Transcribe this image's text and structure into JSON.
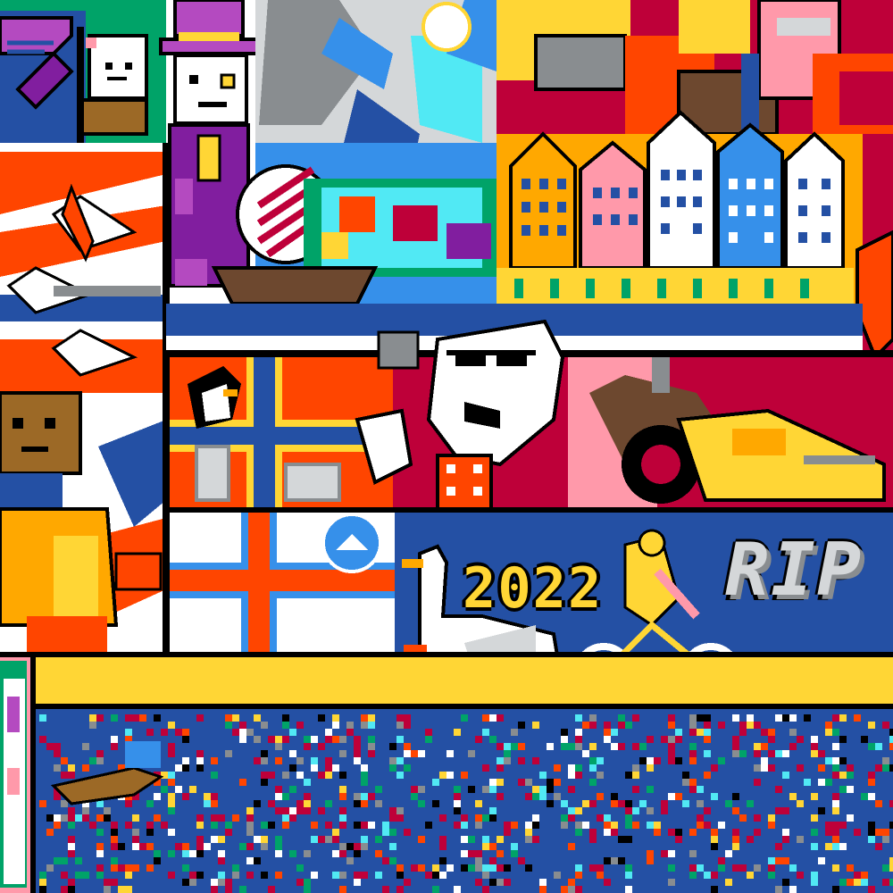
{
  "canvas": {
    "banner_year": "2022",
    "banner_partial_word": "RIP"
  },
  "palette": {
    "red": "#be0039",
    "orange": "#ff4500",
    "yellow": "#ffd635",
    "dark_blue": "#2450a4",
    "blue": "#3690ea",
    "light_blue": "#51e9f4",
    "white": "#ffffff",
    "light_gray": "#d4d7d9",
    "gray": "#898d90",
    "black": "#000000",
    "green": "#00a368",
    "purple": "#811e9f",
    "light_purple": "#b44ac0",
    "pink": "#ff99aa",
    "brown": "#9c6926",
    "dark_brown": "#6d482f"
  }
}
